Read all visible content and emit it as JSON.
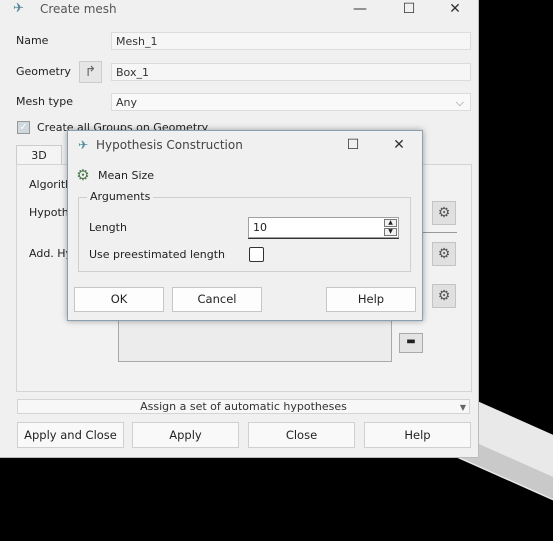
{
  "main_window": {
    "title": "Create mesh",
    "controls": {
      "minimize": "—",
      "maximize": "☐",
      "close": "✕"
    },
    "name_label": "Name",
    "name_value": "Mesh_1",
    "geometry_label": "Geometry",
    "geometry_value": "Box_1",
    "mesh_type_label": "Mesh type",
    "mesh_type_value": "Any",
    "create_groups_label": "Create all Groups on Geometry",
    "create_groups_checked": true,
    "tab_3d": "3D",
    "algorithm_label": "Algorithm",
    "hypothesis_label": "Hypothesis",
    "add_hyp_label": "Add. Hypotheses",
    "assign_label": "Assign a set of automatic hypotheses",
    "buttons": {
      "apply_close": "Apply and Close",
      "apply": "Apply",
      "close": "Close",
      "help": "Help"
    }
  },
  "dialog": {
    "title": "Hypothesis Construction",
    "controls": {
      "maximize": "☐",
      "close": "✕"
    },
    "hypothesis_name": "Mean Size",
    "group_title": "Arguments",
    "length_label": "Length",
    "length_value": "10",
    "preestimated_label": "Use preestimated length",
    "preestimated_checked": false,
    "buttons": {
      "ok": "OK",
      "cancel": "Cancel",
      "help": "Help"
    }
  }
}
